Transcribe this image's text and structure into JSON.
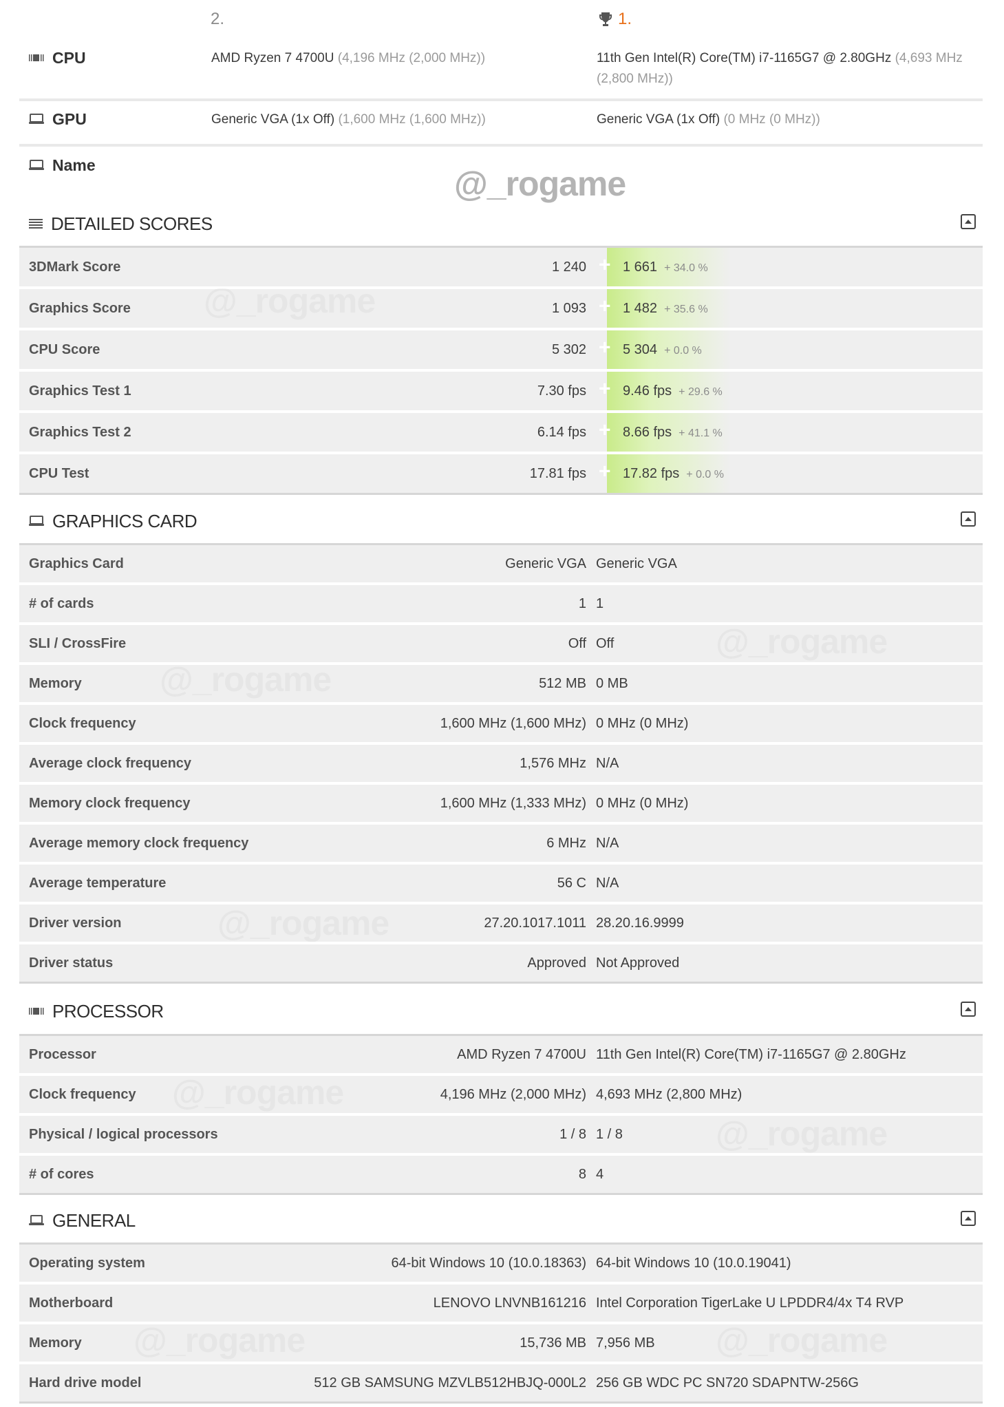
{
  "ranks": {
    "second": "2.",
    "first": "1.",
    "first_icon": "trophy-icon"
  },
  "summary": [
    {
      "label": "CPU",
      "icon": "cpu-icon",
      "a_main": "AMD Ryzen 7 4700U",
      "a_sub": "(4,196 MHz (2,000 MHz))",
      "b_main": "11th Gen Intel(R) Core(TM) i7-1165G7 @ 2.80GHz",
      "b_sub": "(4,693 MHz (2,800 MHz))"
    },
    {
      "label": "GPU",
      "icon": "laptop-icon",
      "a_main": "Generic VGA (1x Off)",
      "a_sub": "(1,600 MHz (1,600 MHz))",
      "b_main": "Generic VGA (1x Off)",
      "b_sub": "(0 MHz (0 MHz))"
    },
    {
      "label": "Name",
      "icon": "laptop-icon",
      "a_main": "",
      "a_sub": "",
      "b_main": "",
      "b_sub": ""
    }
  ],
  "watermark": "@_rogame",
  "sections": {
    "detailed_scores": {
      "title": "DETAILED SCORES",
      "icon": "list-icon",
      "rows": [
        {
          "label": "3DMark Score",
          "a": "1 240",
          "b": "1 661",
          "diff": "+ 34.0 %"
        },
        {
          "label": "Graphics Score",
          "a": "1 093",
          "b": "1 482",
          "diff": "+ 35.6 %"
        },
        {
          "label": "CPU Score",
          "a": "5 302",
          "b": "5 304",
          "diff": "+ 0.0 %"
        },
        {
          "label": "Graphics Test 1",
          "a": "7.30 fps",
          "b": "9.46 fps",
          "diff": "+ 29.6 %"
        },
        {
          "label": "Graphics Test 2",
          "a": "6.14 fps",
          "b": "8.66 fps",
          "diff": "+ 41.1 %"
        },
        {
          "label": "CPU Test",
          "a": "17.81 fps",
          "b": "17.82 fps",
          "diff": "+ 0.0 %"
        }
      ]
    },
    "graphics_card": {
      "title": "GRAPHICS CARD",
      "icon": "laptop-icon",
      "rows": [
        {
          "label": "Graphics Card",
          "a": "Generic VGA",
          "b": "Generic VGA"
        },
        {
          "label": "# of cards",
          "a": "1",
          "b": "1"
        },
        {
          "label": "SLI / CrossFire",
          "a": "Off",
          "b": "Off"
        },
        {
          "label": "Memory",
          "a": "512 MB",
          "b": "0 MB"
        },
        {
          "label": "Clock frequency",
          "a": "1,600 MHz (1,600 MHz)",
          "b": "0 MHz (0 MHz)"
        },
        {
          "label": "Average clock frequency",
          "a": "1,576 MHz",
          "b": "N/A"
        },
        {
          "label": "Memory clock frequency",
          "a": "1,600 MHz (1,333 MHz)",
          "b": "0 MHz (0 MHz)"
        },
        {
          "label": "Average memory clock frequency",
          "a": "6 MHz",
          "b": "N/A"
        },
        {
          "label": "Average temperature",
          "a": "56 C",
          "b": "N/A"
        },
        {
          "label": "Driver version",
          "a": "27.20.1017.1011",
          "b": "28.20.16.9999"
        },
        {
          "label": "Driver status",
          "a": "Approved",
          "b": "Not Approved"
        }
      ]
    },
    "processor": {
      "title": "PROCESSOR",
      "icon": "cpu-icon",
      "rows": [
        {
          "label": "Processor",
          "a": "AMD Ryzen 7 4700U",
          "b": "11th Gen Intel(R) Core(TM) i7-1165G7 @ 2.80GHz"
        },
        {
          "label": "Clock frequency",
          "a": "4,196 MHz (2,000 MHz)",
          "b": "4,693 MHz (2,800 MHz)"
        },
        {
          "label": "Physical / logical processors",
          "a": "1 / 8",
          "b": "1 / 8"
        },
        {
          "label": "# of cores",
          "a": "8",
          "b": "4"
        }
      ]
    },
    "general": {
      "title": "GENERAL",
      "icon": "laptop-icon",
      "rows": [
        {
          "label": "Operating system",
          "a": "64-bit Windows 10 (10.0.18363)",
          "b": "64-bit Windows 10 (10.0.19041)"
        },
        {
          "label": "Motherboard",
          "a": "LENOVO LNVNB161216",
          "b": "Intel Corporation TigerLake U LPDDR4/4x T4 RVP"
        },
        {
          "label": "Memory",
          "a": "15,736 MB",
          "b": "7,956 MB"
        },
        {
          "label": "Hard drive model",
          "a": "512 GB SAMSUNG MZVLB512HBJQ-000L2",
          "b": "256 GB WDC PC SN720 SDAPNTW-256G"
        }
      ]
    }
  },
  "colors": {
    "accent_rank": "#e8701a",
    "better_highlight": "#c9eb8a",
    "row_bg": "#efefef"
  }
}
